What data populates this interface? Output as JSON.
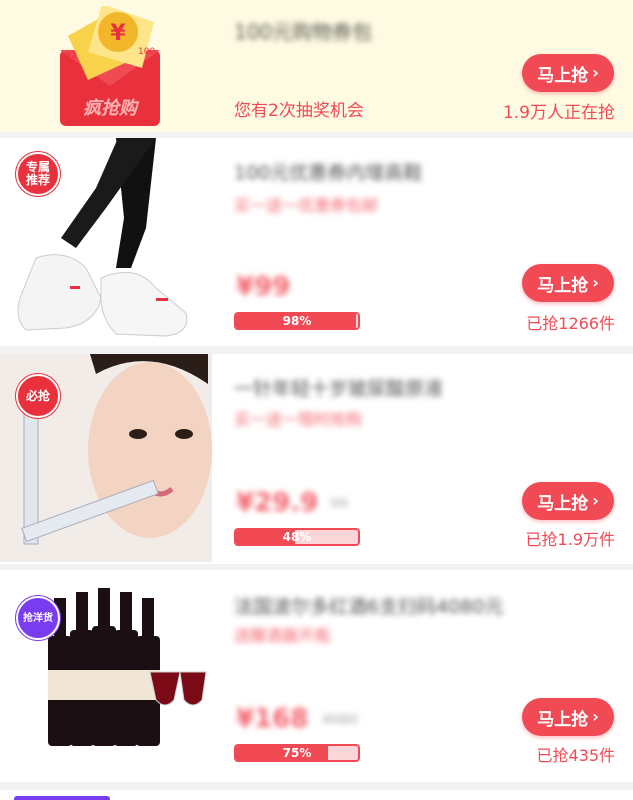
{
  "lottery": {
    "title": "100元购物券包",
    "chance_text": "您有2次抽奖机会",
    "viewers": "1.9万人正在抢",
    "button": "马上抢",
    "icon_text": "抢购",
    "coupon_values": [
      "¥",
      "100",
      "Y2"
    ]
  },
  "products": [
    {
      "badge": [
        "专属",
        "推荐"
      ],
      "title": "100元优惠券内增高鞋",
      "subtitle": "买一送一优惠券包邮",
      "price": "¥99",
      "orig_price": "",
      "progress": 0.98,
      "progress_label": "98%",
      "sold": "已抢1266件",
      "button": "马上抢"
    },
    {
      "badge": [
        "必抢"
      ],
      "title": "一针年轻十岁玻尿酸原液",
      "subtitle": "买一送一限时抢购",
      "price": "¥29.9",
      "orig_price": "99",
      "progress": 0.48,
      "progress_label": "48%",
      "sold": "已抢1.9万件",
      "button": "马上抢"
    },
    {
      "badge": [
        "抢洋货"
      ],
      "title": "法国波尔多红酒6支扫码4080元",
      "subtitle": "送醒酒器开瓶器",
      "price": "¥168",
      "orig_price": "4080",
      "progress": 0.75,
      "progress_label": "75%",
      "sold": "已抢435件",
      "button": "马上抢"
    }
  ],
  "colors": {
    "accent": "#f24a55",
    "lottery_bg": "#fffbe3"
  }
}
